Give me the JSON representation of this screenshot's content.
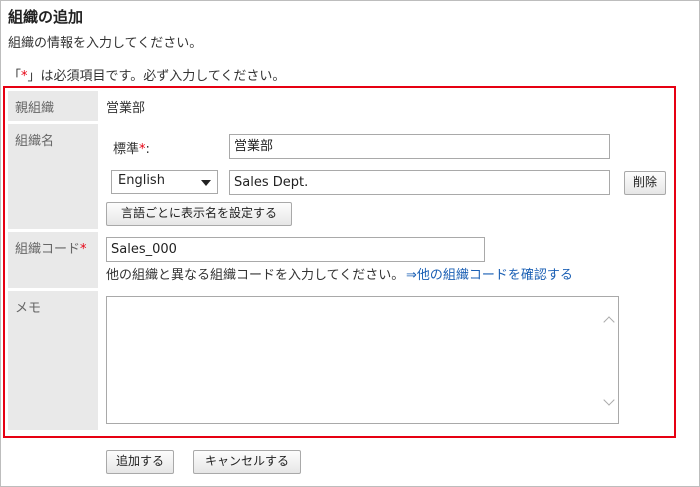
{
  "page": {
    "title": "組織の追加",
    "subtitle": "組織の情報を入力してください。",
    "required_note": {
      "open_quote": "「",
      "asterisk": "*",
      "rest": "」は必須項目です。必ず入力してください。"
    }
  },
  "form": {
    "parent_org": {
      "label": "親組織",
      "value": "営業部"
    },
    "org_name": {
      "label": "組織名",
      "standard_label": "標準",
      "standard_asterisk": "*",
      "standard_colon": ":",
      "standard_value": "営業部",
      "language_selected": "English",
      "language_value": "Sales Dept.",
      "delete_label": "削除",
      "set_display_name_label": "言語ごとに表示名を設定する"
    },
    "org_code": {
      "label": "組織コード",
      "asterisk": "*",
      "value": "Sales_000",
      "help": "他の組織と異なる組織コードを入力してください。",
      "link": "⇒他の組織コードを確認する"
    },
    "memo": {
      "label": "メモ",
      "value": ""
    }
  },
  "actions": {
    "add_label": "追加する",
    "cancel_label": "キャンセルする"
  },
  "colors": {
    "required": "#e60012",
    "highlight_border": "#e60012",
    "label_bg": "#e9e9e9",
    "link": "#1a5fb4"
  }
}
